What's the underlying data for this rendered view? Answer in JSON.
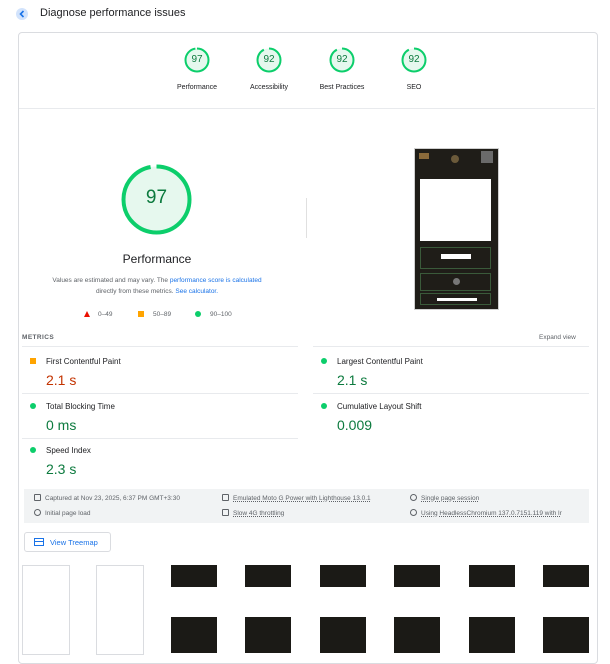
{
  "header": {
    "title": "Diagnose performance issues"
  },
  "categories": [
    {
      "label": "Performance",
      "score": "97"
    },
    {
      "label": "Accessibility",
      "score": "92"
    },
    {
      "label": "Best Practices",
      "score": "92"
    },
    {
      "label": "SEO",
      "score": "92"
    }
  ],
  "main": {
    "score": "97",
    "title": "Performance",
    "desc_1": "Values are estimated and may vary. The ",
    "desc_link_1": "performance score is calculated",
    "desc_2": "directly from these metrics. ",
    "desc_link_2": "See calculator.",
    "legend": [
      "0–49",
      "50–89",
      "90–100"
    ]
  },
  "metrics": {
    "heading": "METRICS",
    "expand_label": "Expand view",
    "items": [
      {
        "title": "First Contentful Paint",
        "value": "2.1 s",
        "status": "average"
      },
      {
        "title": "Largest Contentful Paint",
        "value": "2.1 s",
        "status": "good"
      },
      {
        "title": "Total Blocking Time",
        "value": "0 ms",
        "status": "good"
      },
      {
        "title": "Cumulative Layout Shift",
        "value": "0.009",
        "status": "good"
      },
      {
        "title": "Speed Index",
        "value": "2.3 s",
        "status": "good"
      }
    ]
  },
  "info": {
    "captured": "Captured at Nov 23, 2025, 6:37 PM GMT+3:30",
    "device": "Emulated Moto G Power with Lighthouse 13.0.1",
    "session": "Single page session",
    "load": "Initial page load",
    "throttling": "Slow 4G throttling",
    "browser": "Using HeadlessChromium 137.0.7151.119 with lr"
  },
  "treemap": {
    "label": "View Treemap"
  },
  "colors": {
    "good": "#0cce6b",
    "good_text": "#0c7a3e",
    "average": "#ffa400",
    "poor": "#eb0f00",
    "link": "#1a73e8"
  }
}
